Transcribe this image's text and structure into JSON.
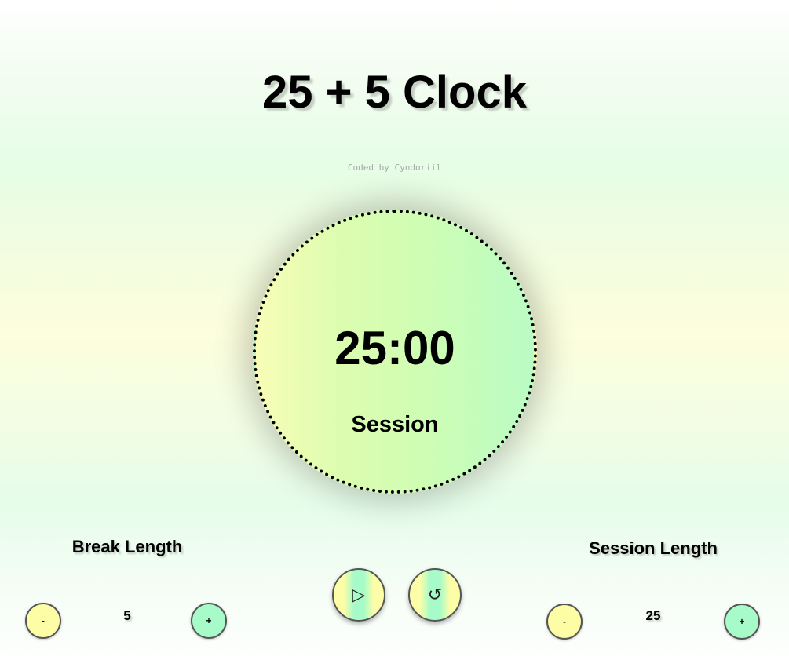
{
  "header": {
    "title": "25 + 5 Clock",
    "credit": "Coded by Cyndoriil"
  },
  "timer": {
    "time": "25:00",
    "label": "Session"
  },
  "break": {
    "title": "Break Length",
    "value": "5",
    "decrement_label": "-",
    "increment_label": "+"
  },
  "session": {
    "title": "Session Length",
    "value": "25",
    "decrement_label": "-",
    "increment_label": "+"
  },
  "controls": {
    "play_icon": "▷",
    "reset_icon": "↺",
    "play_icon_name": "play-icon",
    "reset_icon_name": "reset-icon"
  },
  "colors": {
    "minus_button": "#fdfda6",
    "plus_button": "#a6fbc8",
    "dial_left": "#f8fdb6",
    "dial_right": "#bafcc4"
  }
}
